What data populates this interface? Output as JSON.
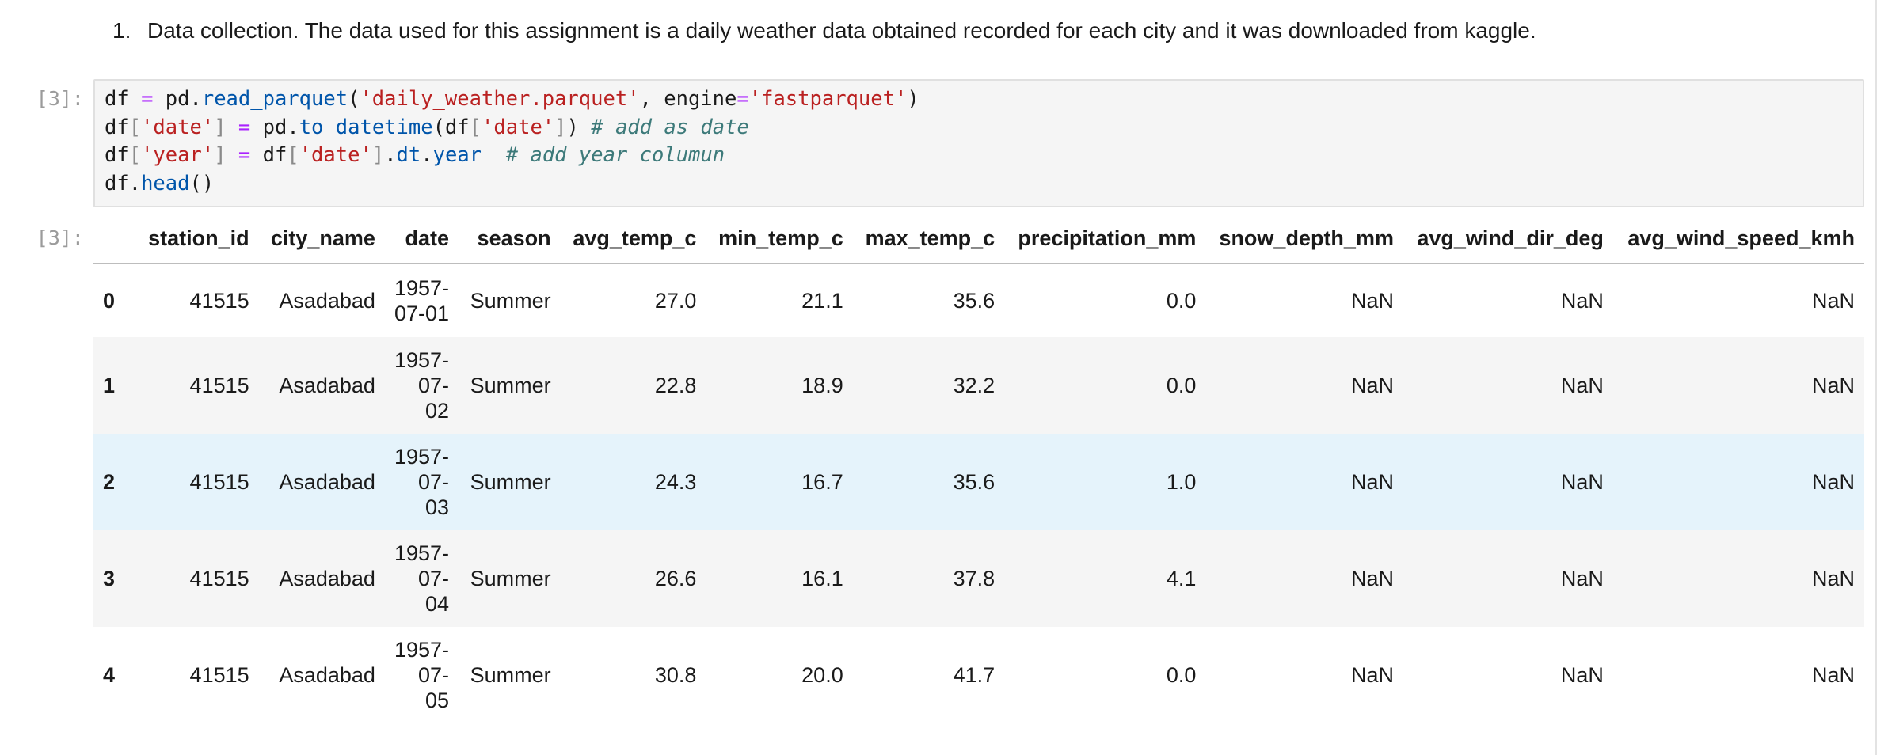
{
  "markdown": {
    "item_number": "1.",
    "item_text": "Data collection. The data used for this assignment is a daily weather data obtained recorded for each city and it was downloaded from kaggle."
  },
  "code_cell": {
    "prompt": "[3]:",
    "lines": [
      [
        [
          "plain",
          "df "
        ],
        [
          "op",
          "="
        ],
        [
          "plain",
          " pd."
        ],
        [
          "attr",
          "read_parquet"
        ],
        [
          "punc",
          "("
        ],
        [
          "str",
          "'daily_weather.parquet'"
        ],
        [
          "plain",
          ", engine"
        ],
        [
          "op",
          "="
        ],
        [
          "str",
          "'fastparquet'"
        ],
        [
          "punc",
          ")"
        ]
      ],
      [
        [
          "plain",
          "df"
        ],
        [
          "br",
          "["
        ],
        [
          "str",
          "'date'"
        ],
        [
          "br",
          "]"
        ],
        [
          "plain",
          " "
        ],
        [
          "op",
          "="
        ],
        [
          "plain",
          " pd."
        ],
        [
          "attr",
          "to_datetime"
        ],
        [
          "punc",
          "("
        ],
        [
          "plain",
          "df"
        ],
        [
          "br",
          "["
        ],
        [
          "str",
          "'date'"
        ],
        [
          "br",
          "]"
        ],
        [
          "punc",
          ")"
        ],
        [
          "plain",
          " "
        ],
        [
          "com",
          "# add as date"
        ]
      ],
      [
        [
          "plain",
          "df"
        ],
        [
          "br",
          "["
        ],
        [
          "str",
          "'year'"
        ],
        [
          "br",
          "]"
        ],
        [
          "plain",
          " "
        ],
        [
          "op",
          "="
        ],
        [
          "plain",
          " df"
        ],
        [
          "br",
          "["
        ],
        [
          "str",
          "'date'"
        ],
        [
          "br",
          "]"
        ],
        [
          "plain",
          "."
        ],
        [
          "attr",
          "dt"
        ],
        [
          "plain",
          "."
        ],
        [
          "attr",
          "year"
        ],
        [
          "plain",
          "  "
        ],
        [
          "com",
          "# add year columun"
        ]
      ],
      [
        [
          "plain",
          "df."
        ],
        [
          "attr",
          "head"
        ],
        [
          "punc",
          "()"
        ]
      ]
    ]
  },
  "output_cell": {
    "prompt": "[3]:",
    "columns": [
      "",
      "station_id",
      "city_name",
      "date",
      "season",
      "avg_temp_c",
      "min_temp_c",
      "max_temp_c",
      "precipitation_mm",
      "snow_depth_mm",
      "avg_wind_dir_deg",
      "avg_wind_speed_kmh"
    ],
    "rows": [
      [
        "0",
        "41515",
        "Asadabad",
        "1957-07-01",
        "Summer",
        "27.0",
        "21.1",
        "35.6",
        "0.0",
        "NaN",
        "NaN",
        "NaN"
      ],
      [
        "1",
        "41515",
        "Asadabad",
        "1957-07-02",
        "Summer",
        "22.8",
        "18.9",
        "32.2",
        "0.0",
        "NaN",
        "NaN",
        "NaN"
      ],
      [
        "2",
        "41515",
        "Asadabad",
        "1957-07-03",
        "Summer",
        "24.3",
        "16.7",
        "35.6",
        "1.0",
        "NaN",
        "NaN",
        "NaN"
      ],
      [
        "3",
        "41515",
        "Asadabad",
        "1957-07-04",
        "Summer",
        "26.6",
        "16.1",
        "37.8",
        "4.1",
        "NaN",
        "NaN",
        "NaN"
      ],
      [
        "4",
        "41515",
        "Asadabad",
        "1957-07-05",
        "Summer",
        "30.8",
        "20.0",
        "41.7",
        "0.0",
        "NaN",
        "NaN",
        "NaN"
      ]
    ]
  }
}
